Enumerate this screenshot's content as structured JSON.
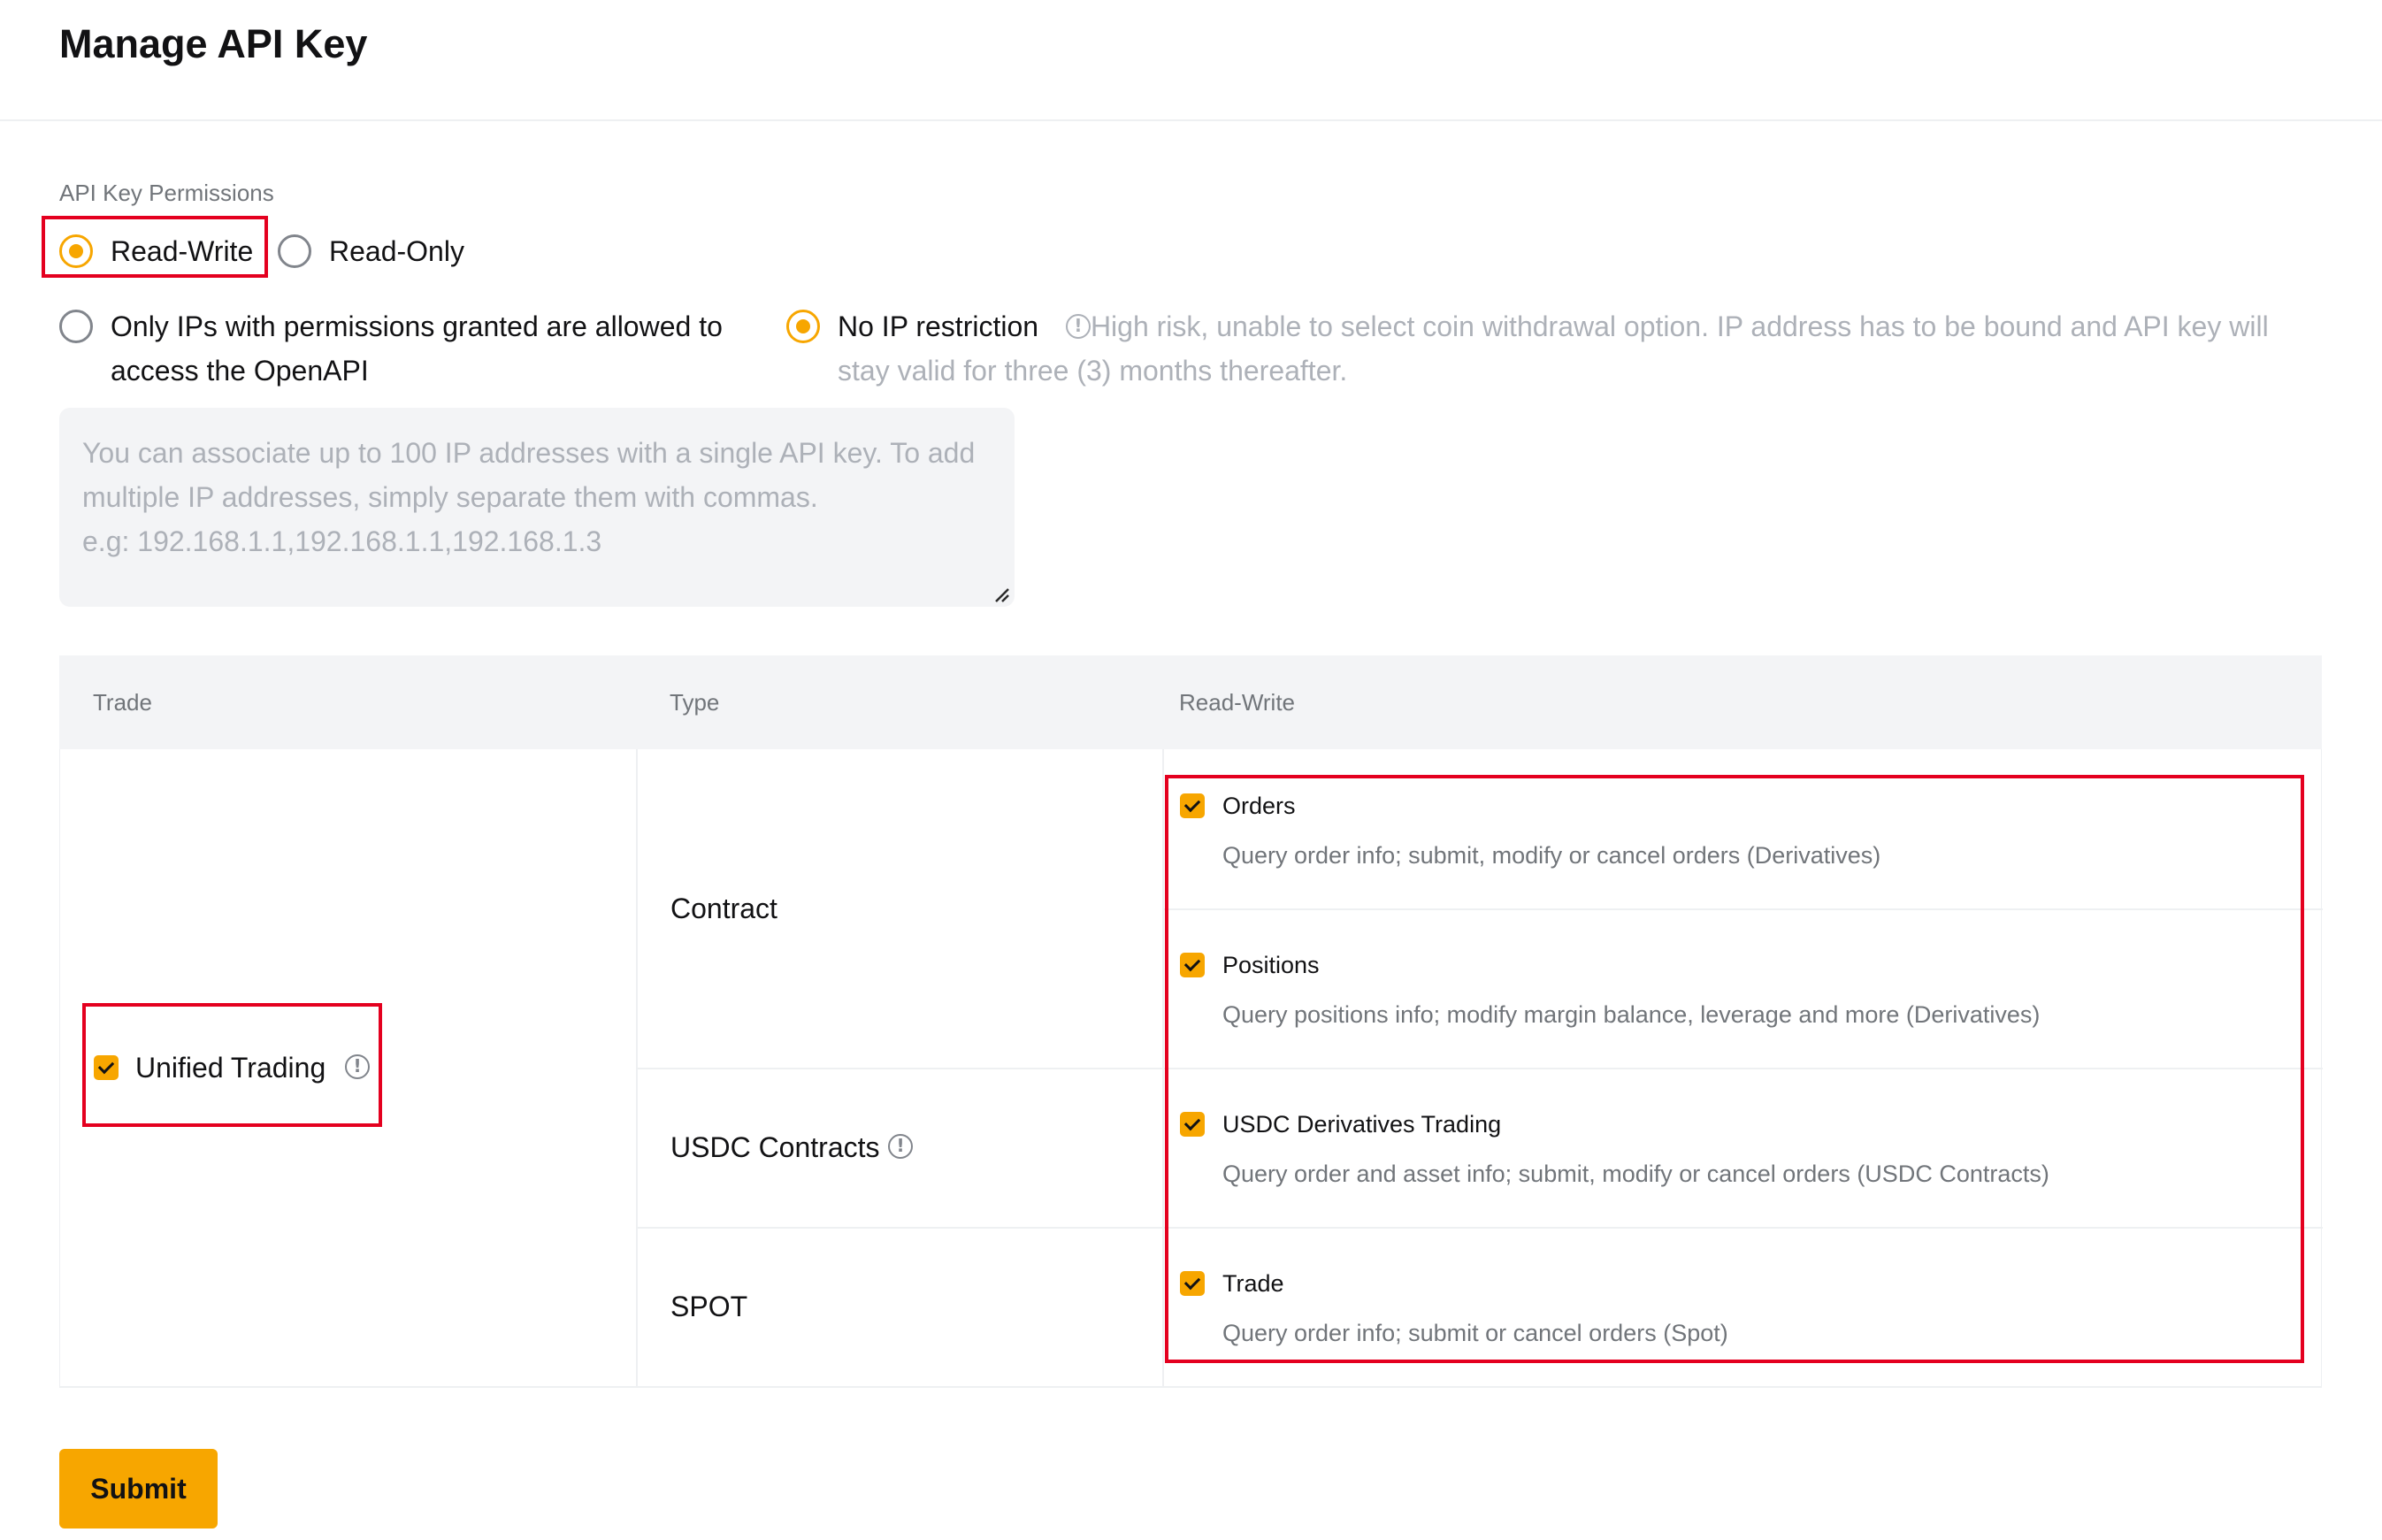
{
  "page": {
    "title": "Manage API Key"
  },
  "permissions": {
    "label": "API Key Permissions",
    "options": [
      {
        "label": "Read-Write",
        "selected": true
      },
      {
        "label": "Read-Only",
        "selected": false
      }
    ]
  },
  "ip_access": {
    "restricted_label": "Only IPs with permissions granted are allowed to access the OpenAPI",
    "restricted_selected": false,
    "unrestricted_label": "No IP restriction",
    "unrestricted_selected": true,
    "unrestricted_warning": "High risk, unable to select coin withdrawal option. IP address has to be bound and API key will stay valid for three (3) months thereafter.",
    "textarea_value": "",
    "textarea_placeholder": "You can associate up to 100 IP addresses with a single API key. To add multiple IP addresses, simply separate them with commas.\ne.g: 192.168.1.1,192.168.1.1,192.168.1.3"
  },
  "table": {
    "headers": {
      "trade": "Trade",
      "type": "Type",
      "read_write": "Read-Write"
    },
    "trade": {
      "label": "Unified Trading",
      "checked": true
    },
    "types": [
      {
        "label": "Contract"
      },
      {
        "label": "USDC Contracts"
      },
      {
        "label": "SPOT"
      }
    ],
    "permissions": [
      {
        "title": "Orders",
        "desc": "Query order info; submit, modify or cancel orders (Derivatives)",
        "checked": true
      },
      {
        "title": "Positions",
        "desc": "Query positions info; modify margin balance, leverage and more (Derivatives)",
        "checked": true
      },
      {
        "title": "USDC Derivatives Trading",
        "desc": "Query order and asset info; submit, modify or cancel orders (USDC Contracts)",
        "checked": true
      },
      {
        "title": "Trade",
        "desc": "Query order info; submit or cancel orders (Spot)",
        "checked": true
      }
    ]
  },
  "actions": {
    "submit_label": "Submit"
  },
  "colors": {
    "accent": "#f7a600",
    "highlight_box": "#e4001f",
    "muted_text": "#71757a",
    "placeholder_text": "#adb1b8",
    "table_header_bg": "#f3f4f6"
  },
  "icons": [
    "info-icon",
    "checkbox-checked-icon",
    "radio-selected-icon",
    "radio-unselected-icon",
    "resize-grip-icon"
  ]
}
